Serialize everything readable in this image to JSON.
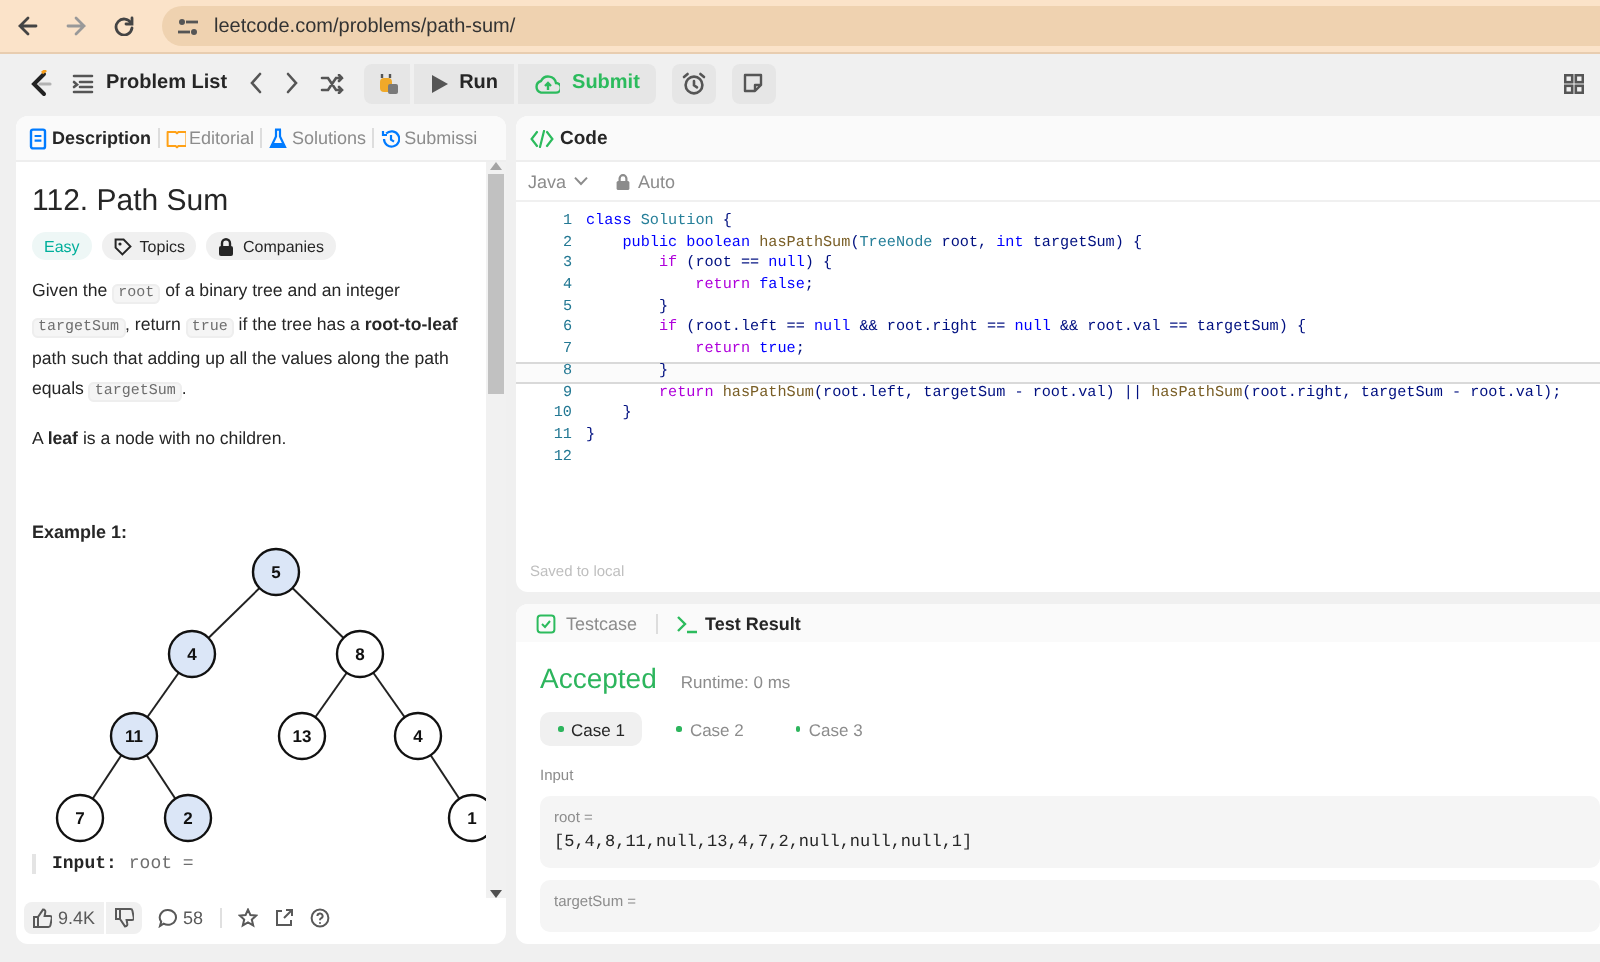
{
  "browser": {
    "url": "leetcode.com/problems/path-sum/"
  },
  "nav": {
    "problem_list": "Problem List",
    "run": "Run",
    "submit": "Submit"
  },
  "description_panel": {
    "tabs": [
      {
        "label": "Description",
        "selected": true
      },
      {
        "label": "Editorial",
        "selected": false
      },
      {
        "label": "Solutions",
        "selected": false
      },
      {
        "label": "Submissi",
        "selected": false
      }
    ],
    "title": "112. Path Sum",
    "tags": [
      {
        "kind": "difficulty",
        "label": "Easy"
      },
      {
        "kind": "topics",
        "label": "Topics"
      },
      {
        "kind": "companies",
        "label": "Companies"
      }
    ],
    "paragraphs": [
      [
        {
          "kind": "text",
          "text": "Given the "
        },
        {
          "kind": "code",
          "text": "root"
        },
        {
          "kind": "text",
          "text": " of a binary tree and an integer "
        },
        {
          "kind": "code",
          "text": "targetSum"
        },
        {
          "kind": "text",
          "text": ", return "
        },
        {
          "kind": "code",
          "text": "true"
        },
        {
          "kind": "text",
          "text": " if the tree has a **root-to-leaf** path such that adding up all the values along the path equals "
        },
        {
          "kind": "code",
          "text": "targetSum"
        },
        {
          "kind": "text",
          "text": "."
        }
      ],
      [
        {
          "kind": "text",
          "text": "A **leaf** is a node with no children."
        }
      ]
    ],
    "example_title": "Example 1:",
    "tree": {
      "value": "5",
      "highlighted": true,
      "left": {
        "value": "4",
        "highlighted": true,
        "left": {
          "value": "11",
          "highlighted": true,
          "left": {
            "value": "7",
            "highlighted": false
          },
          "right": {
            "value": "2",
            "highlighted": true
          }
        }
      },
      "right": {
        "value": "8",
        "highlighted": false,
        "left": {
          "value": "13",
          "highlighted": false
        },
        "right": {
          "value": "4",
          "highlighted": false,
          "right": {
            "value": "1",
            "highlighted": false
          }
        }
      }
    },
    "input": {
      "label": "Input:",
      "value": "root ="
    },
    "footer": {
      "likes": "9.4K",
      "comments": "58"
    }
  },
  "code_panel": {
    "title": "Code",
    "language": "Java",
    "mode": "Auto",
    "lines": [
      {
        "number": "1",
        "current": false,
        "tokens": [
          {
            "kind": "keyword",
            "text": "class"
          },
          {
            "kind": "type",
            "text": " Solution"
          },
          {
            "kind": "plain",
            "text": " {"
          }
        ]
      },
      {
        "number": "2",
        "current": false,
        "tokens": [
          {
            "kind": "keyword",
            "text": "    public"
          },
          {
            "kind": "keyword",
            "text": " boolean"
          },
          {
            "kind": "function",
            "text": " hasPathSum"
          },
          {
            "kind": "plain",
            "text": "("
          },
          {
            "kind": "type",
            "text": "TreeNode"
          },
          {
            "kind": "plain",
            "text": " root, "
          },
          {
            "kind": "keyword",
            "text": "int"
          },
          {
            "kind": "plain",
            "text": " targetSum) {"
          }
        ]
      },
      {
        "number": "3",
        "current": false,
        "tokens": [
          {
            "kind": "control",
            "text": "        if"
          },
          {
            "kind": "plain",
            "text": " (root == "
          },
          {
            "kind": "keyword",
            "text": "null"
          },
          {
            "kind": "plain",
            "text": ") {"
          }
        ]
      },
      {
        "number": "4",
        "current": false,
        "tokens": [
          {
            "kind": "control",
            "text": "            return"
          },
          {
            "kind": "keyword",
            "text": " false"
          },
          {
            "kind": "plain",
            "text": ";"
          }
        ]
      },
      {
        "number": "5",
        "current": false,
        "tokens": [
          {
            "kind": "plain",
            "text": "        }"
          }
        ]
      },
      {
        "number": "6",
        "current": false,
        "tokens": [
          {
            "kind": "control",
            "text": "        if"
          },
          {
            "kind": "plain",
            "text": " (root.left == "
          },
          {
            "kind": "keyword",
            "text": "null"
          },
          {
            "kind": "plain",
            "text": " && root.right == "
          },
          {
            "kind": "keyword",
            "text": "null"
          },
          {
            "kind": "plain",
            "text": " && root.val == targetSum) {"
          }
        ]
      },
      {
        "number": "7",
        "current": false,
        "tokens": [
          {
            "kind": "control",
            "text": "            return"
          },
          {
            "kind": "keyword",
            "text": " true"
          },
          {
            "kind": "plain",
            "text": ";"
          }
        ]
      },
      {
        "number": "8",
        "current": true,
        "tokens": [
          {
            "kind": "plain",
            "text": "        }"
          }
        ]
      },
      {
        "number": "9",
        "current": false,
        "tokens": [
          {
            "kind": "control",
            "text": "        return"
          },
          {
            "kind": "function",
            "text": " hasPathSum"
          },
          {
            "kind": "plain",
            "text": "(root.left, targetSum - root.val) || "
          },
          {
            "kind": "function",
            "text": "hasPathSum"
          },
          {
            "kind": "plain",
            "text": "(root.right, targetSum - root.val);"
          }
        ]
      },
      {
        "number": "10",
        "current": false,
        "tokens": [
          {
            "kind": "plain",
            "text": "    }"
          }
        ]
      },
      {
        "number": "11",
        "current": false,
        "tokens": [
          {
            "kind": "plain",
            "text": "}"
          }
        ]
      },
      {
        "number": "12",
        "current": false
      }
    ],
    "status": "Saved to local"
  },
  "result_panel": {
    "tabs": [
      {
        "label": "Testcase",
        "selected": false
      },
      {
        "label": "Test Result",
        "selected": true
      }
    ],
    "verdict": "Accepted",
    "runtime": "Runtime: 0 ms",
    "cases": [
      {
        "label": "Case 1",
        "selected": true,
        "passed": true
      },
      {
        "label": "Case 2",
        "selected": false,
        "passed": true
      },
      {
        "label": "Case 3",
        "selected": false,
        "passed": true
      }
    ],
    "input_label": "Input",
    "params": [
      {
        "name": "root =",
        "value": "[5,4,8,11,null,13,4,7,2,null,null,null,1]"
      },
      {
        "name": "targetSum ="
      }
    ]
  }
}
